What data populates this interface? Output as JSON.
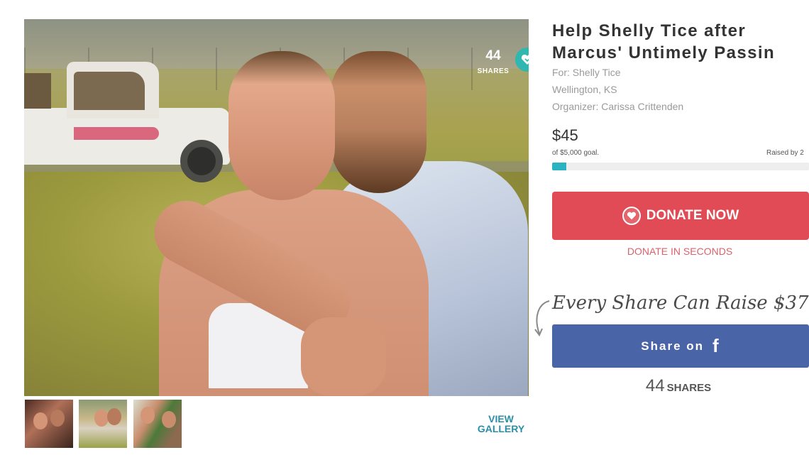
{
  "campaign": {
    "title_line1": "Help Shelly Tice after",
    "title_line2": "Marcus' Untimely Passin",
    "for": "For: Shelly Tice",
    "location": "Wellington, KS",
    "organizer": "Organizer: Carissa Crittenden",
    "raised": "$45",
    "goal": "of $5,000 goal.",
    "raised_by": "Raised by 2",
    "progress_fraction": 0.009
  },
  "photo": {
    "share_count": "44",
    "share_label": "SHARES",
    "gallery_label_1": "VIEW",
    "gallery_label_2": "GALLERY"
  },
  "donate": {
    "button_label": "DONATE NOW",
    "sub_label": "DONATE IN SECONDS"
  },
  "share": {
    "tagline": "Every Share Can Raise $37",
    "button_label": "Share on",
    "facebook_glyph": "f",
    "count": "44",
    "count_label": "SHARES"
  },
  "colors": {
    "donate": "#e14b55",
    "facebook": "#4a64a8",
    "progress": "#2bb3c2",
    "accent": "#2a8fa7"
  },
  "icons": [
    "gofundme-heart-icon",
    "facebook-icon",
    "curved-arrow-icon"
  ]
}
